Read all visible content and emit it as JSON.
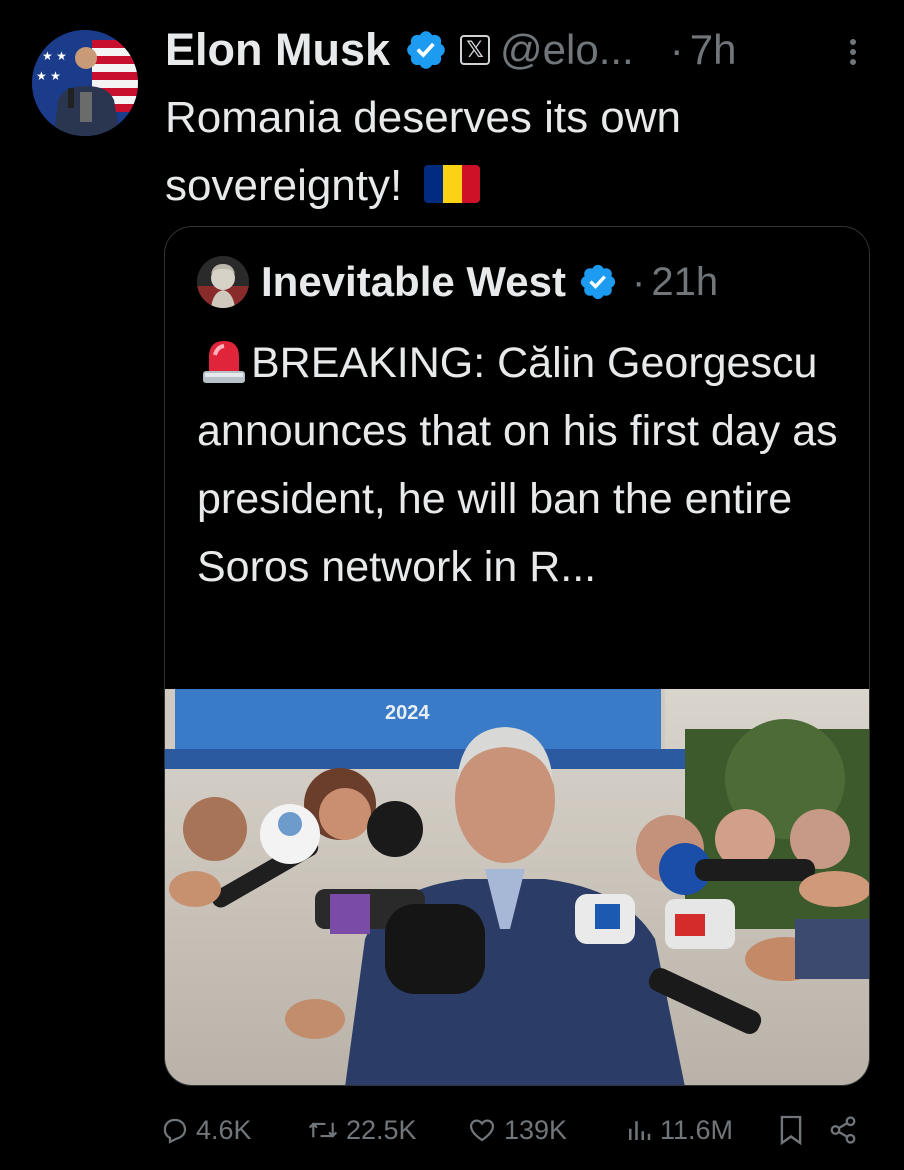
{
  "author": {
    "name": "Elon Musk",
    "handle": "@elo...",
    "time": "7h",
    "avatar_icon": "profile-photo-flag-background"
  },
  "tweet": {
    "text": "Romania deserves its own sovereignty!",
    "flag_icon": "romania-flag",
    "flag_colors": [
      "#002B7F",
      "#FCD116",
      "#CE1126"
    ]
  },
  "quoted": {
    "name": "Inevitable West",
    "time": "21h",
    "text": "BREAKING: Călin Georgescu announces that on his first day as president, he will ban the entire Soros network in R...",
    "siren_icon": "rotating-light-icon",
    "image_text": "2024"
  },
  "actions": {
    "replies": "4.6K",
    "reposts": "22.5K",
    "likes": "139K",
    "views": "11.6M"
  },
  "colors": {
    "background": "#000000",
    "text": "#e7e9ea",
    "muted": "#71767b",
    "verified": "#1d9bf0",
    "border": "#2f3336"
  }
}
